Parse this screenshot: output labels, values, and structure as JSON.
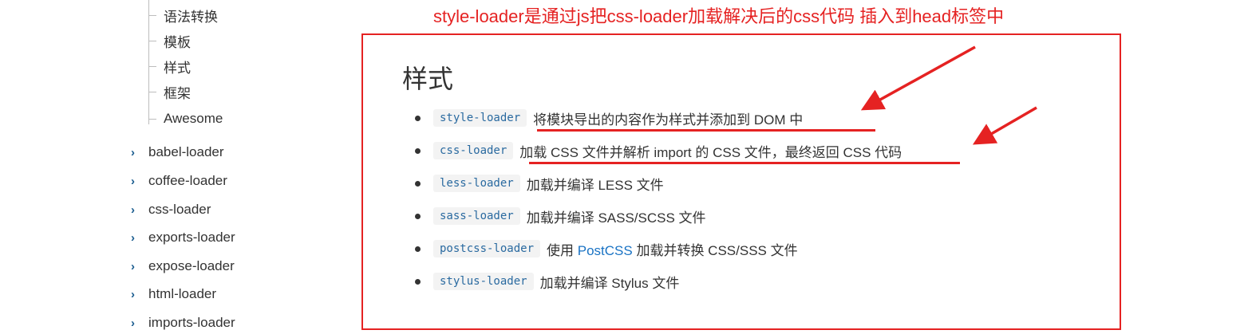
{
  "sidebar": {
    "sub_items": [
      "语法转换",
      "模板",
      "样式",
      "框架",
      "Awesome"
    ],
    "nav_items": [
      "babel-loader",
      "coffee-loader",
      "css-loader",
      "exports-loader",
      "expose-loader",
      "html-loader",
      "imports-loader"
    ]
  },
  "annotation": {
    "text": "style-loader是通过js把css-loader加载解决后的css代码 插入到head标签中",
    "color": "#e52222"
  },
  "content": {
    "heading": "样式",
    "items": [
      {
        "code": "style-loader",
        "desc": "将模块导出的内容作为样式并添加到 DOM 中"
      },
      {
        "code": "css-loader",
        "desc": "加载 CSS 文件并解析 import 的 CSS 文件，最终返回 CSS 代码"
      },
      {
        "code": "less-loader",
        "desc": "加载并编译 LESS 文件"
      },
      {
        "code": "sass-loader",
        "desc": "加载并编译 SASS/SCSS 文件"
      },
      {
        "code": "postcss-loader",
        "desc_pre": "使用 ",
        "link": "PostCSS",
        "desc_post": " 加载并转换 CSS/SSS 文件"
      },
      {
        "code": "stylus-loader",
        "desc": "加载并编译 Stylus 文件"
      }
    ]
  },
  "colors": {
    "code_text": "#2a6aa0",
    "link": "#1a73c4",
    "chevron": "#1a5c8f",
    "annotation_red": "#e52222"
  }
}
